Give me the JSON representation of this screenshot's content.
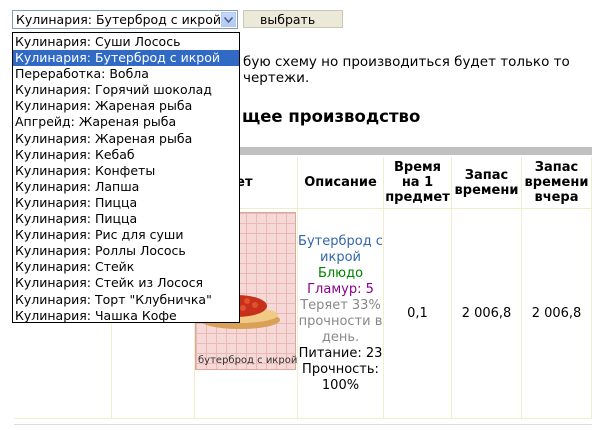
{
  "select": {
    "value": "Кулинария: Бутерброд с икрой",
    "button_label": "выбрать"
  },
  "dropdown": {
    "options": [
      "Кулинария: Суши Лосось",
      "Кулинария: Бутерброд с икрой",
      "Переработка: Вобла",
      "Кулинария: Горячий шоколад",
      "Кулинария: Жареная рыба",
      "Апгрейд: Жареная рыба",
      "Кулинария: Жареная рыба",
      "Кулинария: Кебаб",
      "Кулинария: Конфеты",
      "Кулинария: Лапша",
      "Кулинария: Пицца",
      "Кулинария: Пицца",
      "Кулинария: Рис для суши",
      "Кулинария: Роллы Лосось",
      "Кулинария: Стейк",
      "Кулинария: Стейк из Лосося",
      "Кулинария: Торт \"Клубничка\"",
      "Кулинария: Чашка Кофе"
    ],
    "selected_index": 1
  },
  "background_text": {
    "line1": "бую схему но производиться будет только то",
    "line2": "чертежи.",
    "section_title": "щее производство"
  },
  "table": {
    "headers": {
      "item": "дмет",
      "description": "Описание",
      "time_per_item": "Время на 1 предмет",
      "time_stock": "Запас времени",
      "time_stock_yesterday": "Запас времени вчера"
    },
    "row": {
      "item_name": "Бутерброд с икрой",
      "item_type": "Блюдо",
      "glamour": "Гламур: 5",
      "decay": "Теряет 33% прочности в день.",
      "nutrition": "Питание: 23",
      "durability": "Прочность: 100%",
      "image_label": "бутерброд с икрой",
      "time_per_item": "0,1",
      "time_stock": "2 006,8",
      "time_stock_yesterday": "2 006,8"
    }
  },
  "colors": {
    "selection": "#316ac5",
    "link_blue": "#3366aa",
    "type_green": "#008000",
    "glamour_purple": "#8b008b",
    "muted_gray": "#888888"
  }
}
